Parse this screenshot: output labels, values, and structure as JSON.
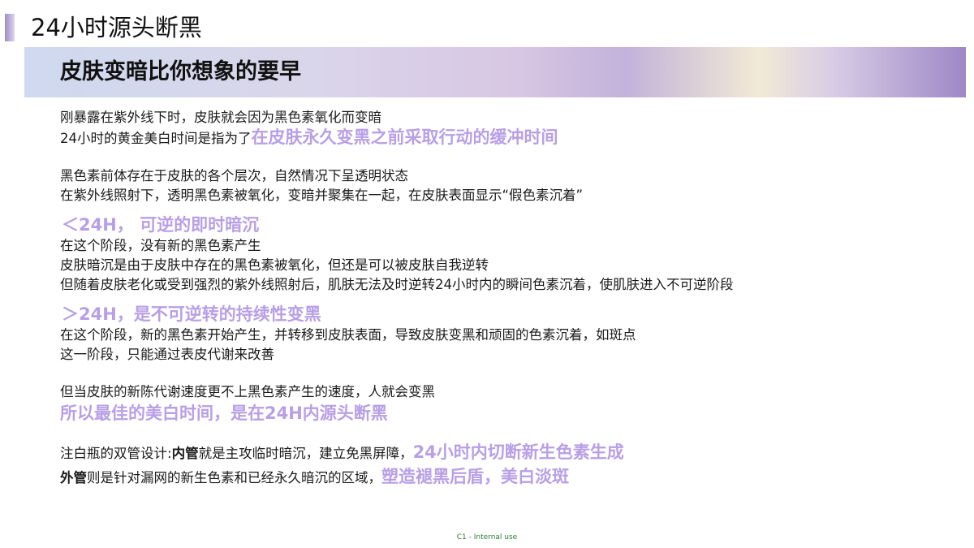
{
  "header": {
    "page_title": "24小时源头断黑",
    "banner_title": "皮肤变暗比你想象的要早"
  },
  "section1": {
    "line1": "刚暴露在紫外线下时，皮肤就会因为黑色素氧化而变暗",
    "line2_prefix": "24小时的黄金美白时间是指为了",
    "line2_highlight": "在皮肤永久变黑之前采取行动的缓冲时间"
  },
  "section2": {
    "line1": "黑色素前体存在于皮肤的各个层次，自然情况下呈透明状态",
    "line2": "在紫外线照射下，透明黑色素被氧化，变暗并聚集在一起，在皮肤表面显示“假色素沉着”"
  },
  "section3": {
    "heading": "＜24H， 可逆的即时暗沉",
    "line1": "在这个阶段，没有新的黑色素产生",
    "line2": "皮肤暗沉是由于皮肤中存在的黑色素被氧化，但还是可以被皮肤自我逆转",
    "line3": "但随着皮肤老化或受到强烈的紫外线照射后，肌肤无法及时逆转24小时内的瞬间色素沉着，使肌肤进入不可逆阶段"
  },
  "section4": {
    "heading": "＞24H，是不可逆转的持续性变黑",
    "line1": "在这个阶段，新的黑色素开始产生，并转移到皮肤表面，导致皮肤变黑和顽固的色素沉着，如斑点",
    "line2": "这一阶段，只能通过表皮代谢来改善"
  },
  "section5": {
    "line1": "但当皮肤的新陈代谢速度更不上黑色素产生的速度，人就会变黑",
    "highlight": "所以最佳的美白时间，是在24H内源头断黑"
  },
  "section6": {
    "line1_prefix": "注白瓶的双管设计:",
    "line1_bold": "内管",
    "line1_mid": "就是主攻临时暗沉，建立免黑屏障，",
    "line1_highlight": "24小时内切断新生色素生成",
    "line2_bold": "外管",
    "line2_mid": "则是针对漏网的新生色素和已经永久暗沉的区域，",
    "line2_highlight": "塑造褪黑后盾，美白淡斑"
  },
  "footer": {
    "label": "C1 - Internal use"
  },
  "colors": {
    "highlight": "#b89fe6",
    "footer": "#2e7d32"
  }
}
